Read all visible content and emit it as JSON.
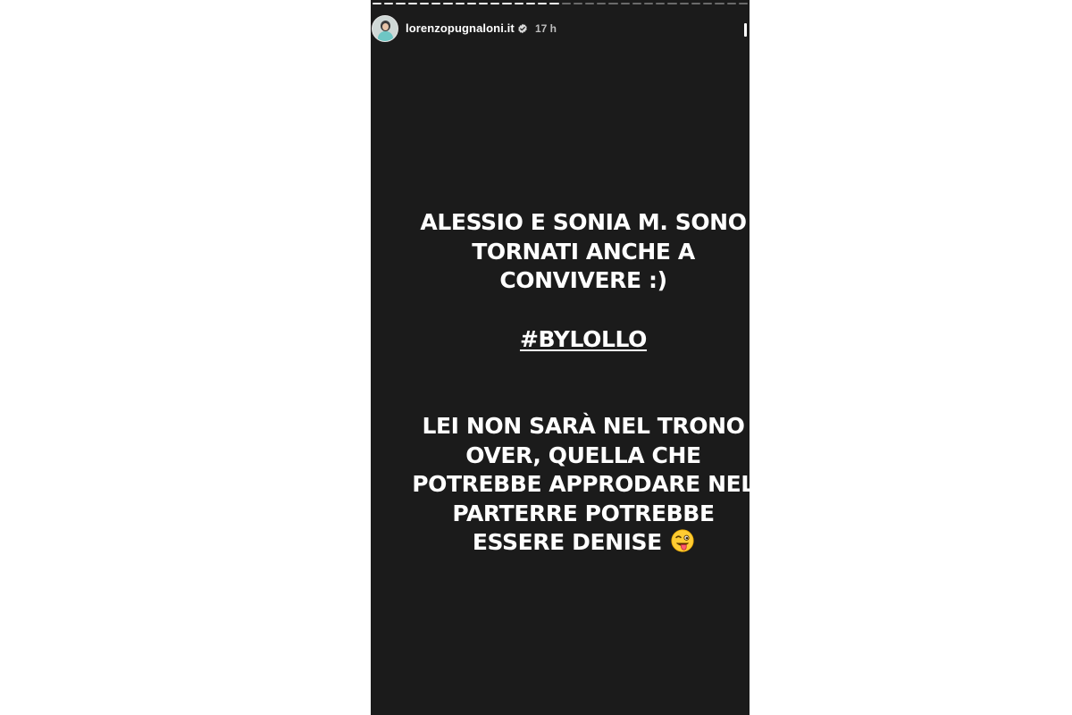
{
  "story": {
    "progress_segments_total": 32,
    "progress_segments_done": 16,
    "header": {
      "username": "lorenzopugnaloni.it",
      "verified_icon": "verified-badge-icon",
      "time": "17 h",
      "pause_icon": "pause-icon"
    },
    "content": {
      "lines_top": [
        "ALESSIO E SONIA M. SONO",
        "TORNATI ANCHE A",
        "CONVIVERE :)"
      ],
      "hashtag": "#BYLOLLO",
      "lines_bottom": [
        "LEI NON SARÀ NEL TRONO",
        "OVER, QUELLA CHE",
        "POTREBBE APPRODARE NEL",
        "PARTERRE POTREBBE",
        "ESSERE DENISE"
      ],
      "emoji": "winking-face-with-tongue-emoji"
    },
    "colors": {
      "background": "#1b1b1b",
      "text": "#ffffff"
    }
  }
}
